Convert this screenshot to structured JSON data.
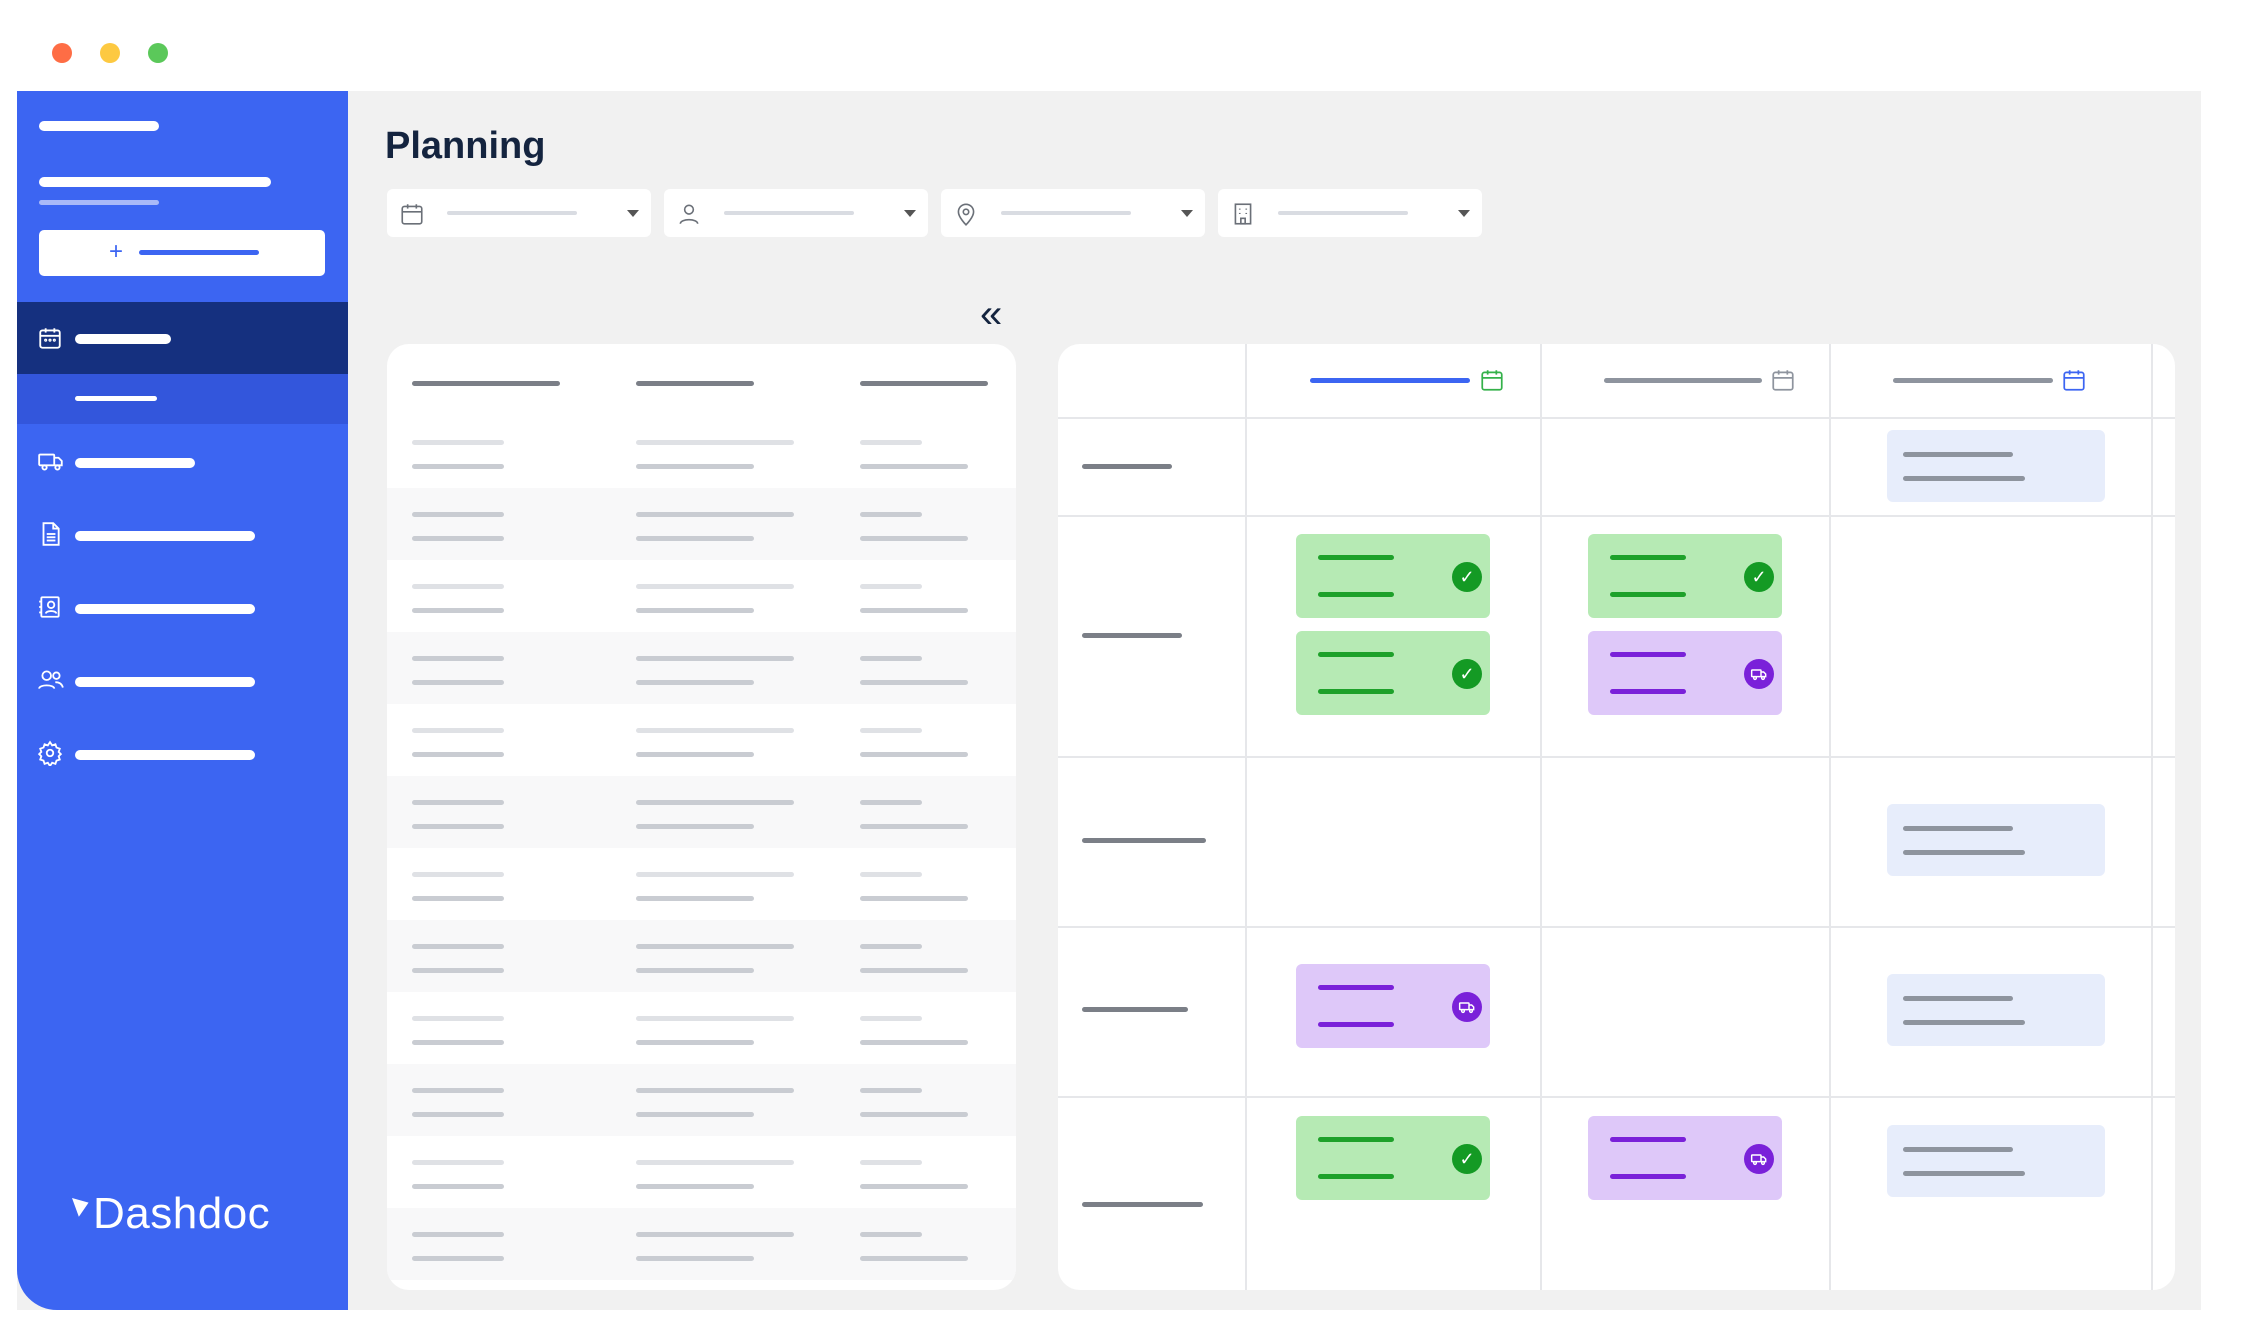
{
  "window": {
    "controls": [
      {
        "name": "close",
        "color": "#fe6d45"
      },
      {
        "name": "minimize",
        "color": "#fdc941"
      },
      {
        "name": "maximize",
        "color": "#5bc85a"
      }
    ]
  },
  "brand": {
    "name": "Dashdoc",
    "color": "#3c65f2"
  },
  "page": {
    "title": "Planning"
  },
  "filters": [
    {
      "icon": "calendar-icon"
    },
    {
      "icon": "user-icon"
    },
    {
      "icon": "location-pin-icon"
    },
    {
      "icon": "building-icon"
    }
  ],
  "sidebar": {
    "items": [
      {
        "icon": "calendar-icon",
        "active": true
      },
      {
        "icon": "truck-icon"
      },
      {
        "icon": "document-icon"
      },
      {
        "icon": "address-book-icon"
      },
      {
        "icon": "users-icon"
      },
      {
        "icon": "settings-gear-icon"
      }
    ]
  },
  "planning": {
    "columns": [
      {
        "highlight": true,
        "icon": "calendar-icon",
        "icon_color": "#34b14a"
      },
      {
        "highlight": false,
        "icon": "calendar-icon",
        "icon_color": "#8e949e"
      },
      {
        "highlight": false,
        "icon": "calendar-icon",
        "icon_color": "#3c65f2"
      }
    ],
    "card_status": {
      "done": {
        "icon": "check-icon",
        "color": "#149a24"
      },
      "in_transit": {
        "icon": "truck-icon",
        "color": "#7a21d9"
      }
    }
  },
  "colors": {
    "sidebar_bg": "#3c65f2",
    "sidebar_active": "#15307f",
    "card_green": "#b6eab4",
    "card_purple": "#dec8f9",
    "card_ghost": "#e7edfb"
  }
}
